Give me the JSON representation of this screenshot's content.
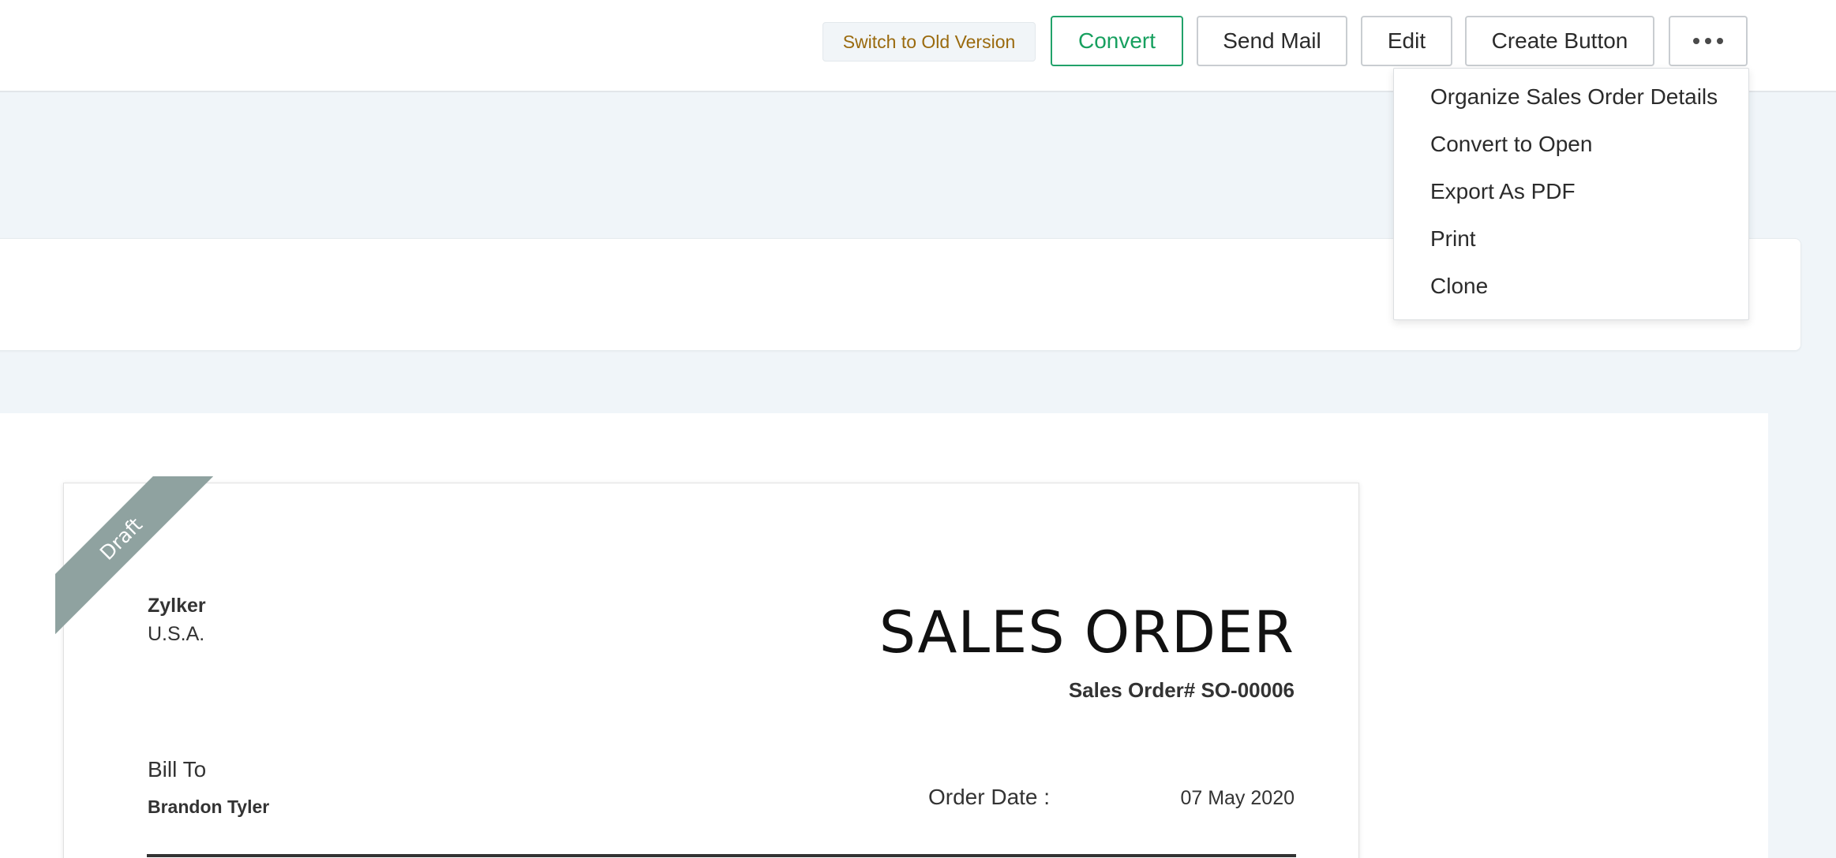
{
  "toolbar": {
    "switch_old_version": "Switch to Old Version",
    "convert": "Convert",
    "send_mail": "Send Mail",
    "edit": "Edit",
    "create_button": "Create Button"
  },
  "more_menu": {
    "items": [
      "Organize Sales Order Details",
      "Convert to Open",
      "Export As PDF",
      "Print",
      "Clone"
    ]
  },
  "sales_order": {
    "status_ribbon": "Draft",
    "company_name": "Zylker",
    "company_country": "U.S.A.",
    "title": "SALES ORDER",
    "number_label": "Sales Order# SO-00006",
    "bill_to_label": "Bill To",
    "bill_to_name": "Brandon Tyler",
    "order_date_label": "Order Date :",
    "order_date_value": "07 May 2020"
  },
  "colors": {
    "accent_green": "#17a05f",
    "old_version_text": "#9a6a0e",
    "ribbon": "#8fa2a0",
    "page_background": "#f0f5f9"
  }
}
